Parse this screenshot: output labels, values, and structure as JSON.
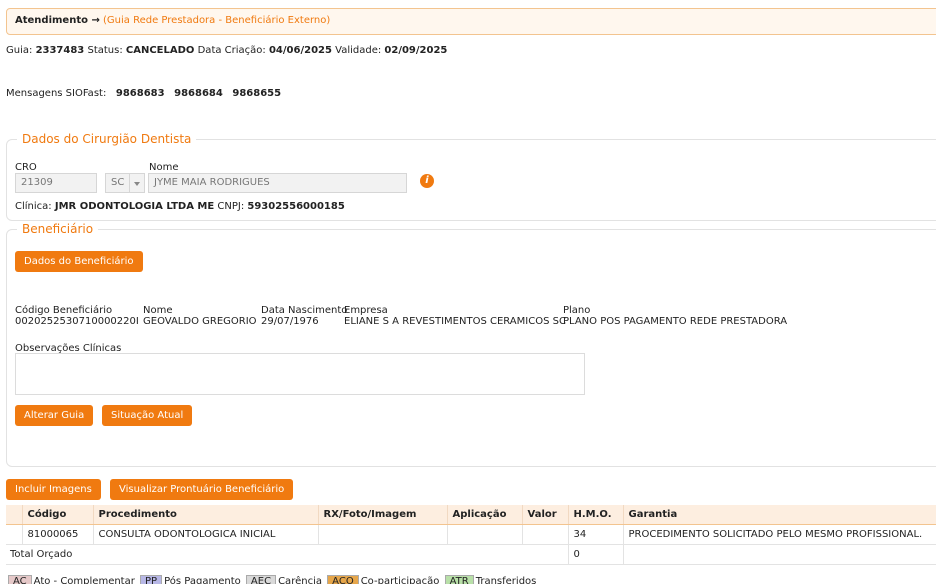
{
  "breadcrumb": {
    "title": "Atendimento →",
    "subtitle": "(Guia Rede Prestadora - Beneficiário Externo)"
  },
  "guide_info": {
    "guia_label": "Guia:",
    "guia_value": "2337483",
    "status_label": "Status:",
    "status_value": "CANCELADO",
    "created_label": "Data Criação:",
    "created_value": "04/06/2025",
    "validity_label": "Validade:",
    "validity_value": "02/09/2025"
  },
  "messages": {
    "label": "Mensagens SIOFast:",
    "values": [
      "9868683",
      "9868684",
      "9868655"
    ]
  },
  "dentist": {
    "legend": "Dados do Cirurgião Dentista",
    "cro_label": "CRO",
    "cro_value": "21309",
    "uf_value": "SC",
    "name_label": "Nome",
    "name_value": "JYME MAIA RODRIGUES",
    "clinic_label": "Clínica:",
    "clinic_value": "JMR ODONTOLOGIA LTDA ME",
    "cnpj_label": "CNPJ:",
    "cnpj_value": "59302556000185",
    "info_icon": "i"
  },
  "beneficiary": {
    "legend": "Beneficiário",
    "data_button": "Dados do Beneficiário",
    "code_label": "Código Beneficiário",
    "code_value": "0020252530710000220I",
    "name_label": "Nome",
    "name_value": "GEOVALDO GREGORIO",
    "birth_label": "Data Nascimento",
    "birth_value": "29/07/1976",
    "company_label": "Empresa",
    "company_value": "ELIANE S A REVESTIMENTOS CERAMICOS SC",
    "plan_label": "Plano",
    "plan_value": "PLANO POS PAGAMENTO REDE PRESTADORA",
    "notes_label": "Observações Clínicas",
    "alter_button": "Alterar Guia",
    "status_button": "Situação Atual"
  },
  "actions": {
    "include_images": "Incluir Imagens",
    "view_records": "Visualizar Prontuário Beneficiário"
  },
  "procedures": {
    "headers": [
      "",
      "Código",
      "Procedimento",
      "RX/Foto/Imagem",
      "Aplicação",
      "Valor",
      "H.M.O.",
      "Garantia"
    ],
    "rows": [
      {
        "flag": "",
        "code": "81000065",
        "procedure": "CONSULTA ODONTOLOGICA INICIAL",
        "rx": "",
        "application": "",
        "value": "",
        "hmo": "34",
        "guarantee": "PROCEDIMENTO SOLICITADO PELO MESMO PROFISSIONAL."
      }
    ],
    "total_label": "Total Orçado",
    "total_hmo": "0"
  },
  "legend_items": [
    {
      "code": "AC",
      "label": "Ato - Complementar",
      "color": "#e6c9c9"
    },
    {
      "code": "PP",
      "label": "Pós Pagamento",
      "color": "#b7b7e6"
    },
    {
      "code": "AEC",
      "label": "Carência",
      "color": "#d9d9d9"
    },
    {
      "code": "ACO",
      "label": "Co-participação",
      "color": "#e6a64a"
    },
    {
      "code": "ATR",
      "label": "Transferidos",
      "color": "#b8e0a8"
    }
  ]
}
